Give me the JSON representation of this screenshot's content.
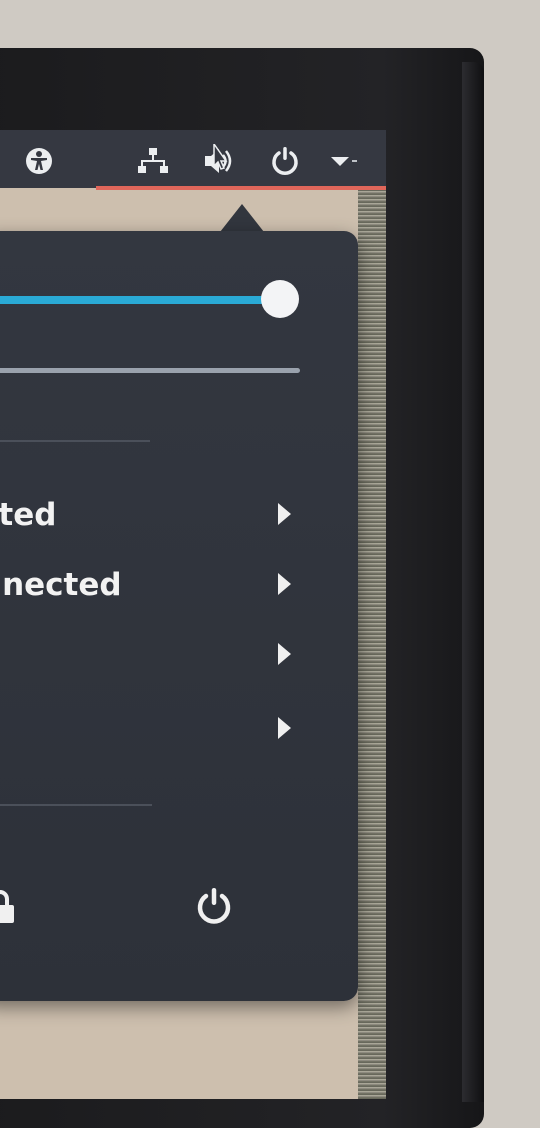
{
  "top_panel": {
    "icons": [
      "accessibility-icon",
      "network-icon",
      "volume-icon",
      "power-icon",
      "dropdown-arrow-icon"
    ]
  },
  "system_menu": {
    "brightness_level": 1.0,
    "volume_level": 1.0,
    "rows": [
      {
        "label": "cted",
        "icon": "chevron-right-icon"
      },
      {
        "label": "nnected",
        "icon": "chevron-right-icon"
      },
      {
        "label": "",
        "icon": "chevron-right-icon"
      },
      {
        "label": "",
        "icon": "chevron-right-icon"
      }
    ],
    "bottom_buttons": [
      "lock-icon",
      "power-off-icon"
    ]
  },
  "colors": {
    "panel_bg": "#353841",
    "menu_bg": "#32363e",
    "accent_slider": "#2aaad6",
    "indicator_underline": "#e0665a",
    "text": "#f2f2f2"
  }
}
